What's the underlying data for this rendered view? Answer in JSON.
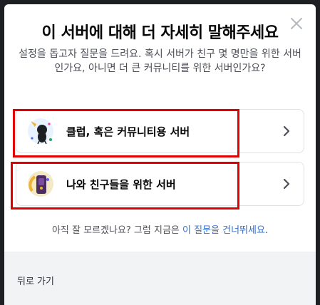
{
  "modal": {
    "title": "이 서버에 대해 더 자세히 말해주세요",
    "subtitle": "설정을 돕고자 질문을 드려요. 혹시 서버가 친구 몇 명만을 위한 서버인가요, 아니면 더 큰 커뮤니티를 위한 서버인가요?",
    "close_icon": "close-icon"
  },
  "options": [
    {
      "label": "클럽, 혹은 커뮤니티용 서버",
      "icon": "club-community-icon"
    },
    {
      "label": "나와 친구들을 위한 서버",
      "icon": "friends-icon"
    }
  ],
  "skip": {
    "prefix": "아직 잘 모르겠나요? 그럼 지금은 ",
    "link": "이 질문을 건너뛰세요",
    "suffix": "."
  },
  "footer": {
    "back_label": "뒤로 가기"
  },
  "colors": {
    "highlight": "#e00000",
    "link": "#2f6fd6"
  }
}
